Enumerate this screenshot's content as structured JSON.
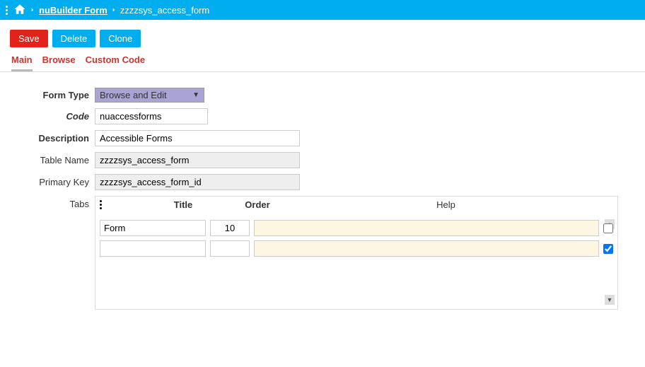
{
  "breadcrumb": {
    "home_link": "nuBuilder Form",
    "current": "zzzzsys_access_form"
  },
  "toolbar": {
    "save": "Save",
    "delete": "Delete",
    "clone": "Clone"
  },
  "tabs": {
    "main": "Main",
    "browse": "Browse",
    "custom": "Custom Code"
  },
  "fields": {
    "form_type_label": "Form Type",
    "form_type_value": "Browse and Edit",
    "code_label": "Code",
    "code_value": "nuaccessforms",
    "description_label": "Description",
    "description_value": "Accessible Forms",
    "table_label": "Table Name",
    "table_value": "zzzzsys_access_form",
    "pk_label": "Primary Key",
    "pk_value": "zzzzsys_access_form_id",
    "tabs_label": "Tabs"
  },
  "tabs_grid": {
    "headers": {
      "title": "Title",
      "order": "Order",
      "help": "Help"
    },
    "rows": [
      {
        "title": "Form",
        "order": "10",
        "help": "",
        "checked": false
      },
      {
        "title": "",
        "order": "",
        "help": "",
        "checked": true
      }
    ]
  }
}
